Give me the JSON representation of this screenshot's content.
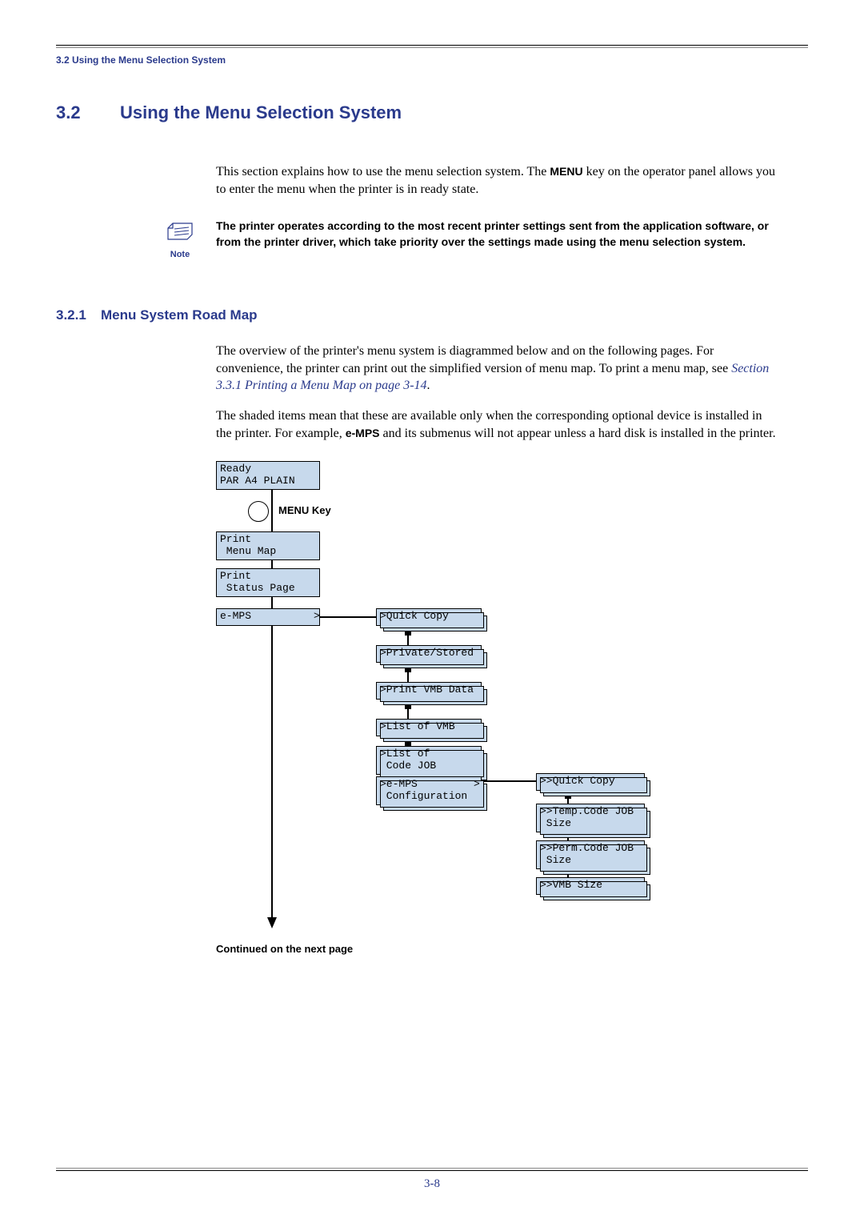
{
  "header": {
    "running": "3.2 Using the Menu Selection System"
  },
  "section": {
    "number": "3.2",
    "title": "Using the Menu Selection System",
    "intro_pre": "This section explains how to use the menu selection system. The ",
    "intro_key": "MENU",
    "intro_post": " key on the operator panel allows you to enter the menu when the printer is in ready state."
  },
  "note": {
    "label": "Note",
    "text": "The printer operates according to the most recent printer settings sent from the application software, or from the printer driver, which take priority over the settings made using the menu selection system."
  },
  "subsection": {
    "number": "3.2.1",
    "title": "Menu System Road Map",
    "p1_pre": "The overview of the printer's menu system is diagrammed below and on the following pages. For convenience, the printer can print out the simplified version of menu map. To print a menu map, see ",
    "p1_xref": "Section 3.3.1 Printing a Menu Map on page 3-14",
    "p1_post": ".",
    "p2_pre": "The shaded items mean that these are available only when the corresponding optional device is installed in the printer. For example, ",
    "p2_emps": "e-MPS",
    "p2_post": " and its submenus will not appear unless a hard disk is installed in the printer."
  },
  "diagram": {
    "ready_l1": "Ready",
    "ready_l2": "PAR A4 PLAIN",
    "menu_key": "MENU Key",
    "print_menu_l1": "Print",
    "print_menu_l2": " Menu Map",
    "print_status_l1": "Print",
    "print_status_l2": " Status Page",
    "emps": "e-MPS          >",
    "sub": {
      "quick": ">Quick Copy",
      "private": ">Private/Stored",
      "vmb": ">Print VMB Data",
      "listvmb": ">List of VMB",
      "listcode_l1": ">List of",
      "listcode_l2": " Code JOB",
      "config_l1": ">e-MPS         >",
      "config_l2": " Configuration"
    },
    "sub2": {
      "quick": ">>Quick Copy",
      "temp_l1": ">>Temp.Code JOB",
      "temp_l2": " Size",
      "perm_l1": ">>Perm.Code JOB",
      "perm_l2": " Size",
      "vmb": ">>VMB Size"
    }
  },
  "continued": "Continued on the next page",
  "page_number": "3-8"
}
